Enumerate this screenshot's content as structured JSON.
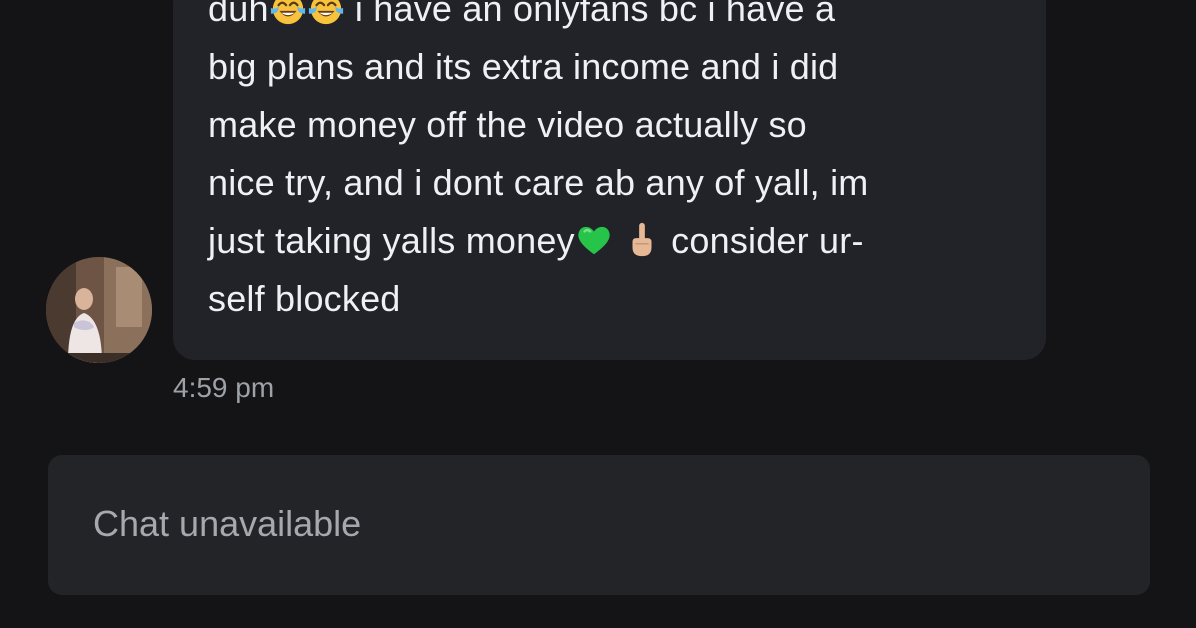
{
  "conversation": {
    "message": {
      "lines": [
        {
          "parts": [
            {
              "text": "duh"
            },
            {
              "emoji": "face-with-tears-of-joy"
            },
            {
              "emoji": "face-with-tears-of-joy"
            },
            {
              "text": " i have an onlyfans bc i have a"
            }
          ]
        },
        {
          "parts": [
            {
              "text": "big plans and its extra income and i did"
            }
          ]
        },
        {
          "parts": [
            {
              "text": "make money off the video actually so"
            }
          ]
        },
        {
          "parts": [
            {
              "text": "nice try, and i dont care ab any of yall, im"
            }
          ]
        },
        {
          "parts": [
            {
              "text": "just taking yalls money"
            },
            {
              "emoji": "green-heart"
            },
            {
              "text": " "
            },
            {
              "emoji": "middle-finger"
            },
            {
              "text": " consider ur-"
            }
          ]
        },
        {
          "parts": [
            {
              "text": "self blocked"
            }
          ]
        }
      ],
      "timestamp": "4:59 pm"
    },
    "sender": {
      "avatar_icon": "profile-photo"
    }
  },
  "composer": {
    "label": "Chat unavailable"
  },
  "colors": {
    "background": "#141416",
    "bubble": "#222328",
    "composer": "#232428",
    "text": "#eef0f4",
    "muted": "#9ea1a8"
  }
}
